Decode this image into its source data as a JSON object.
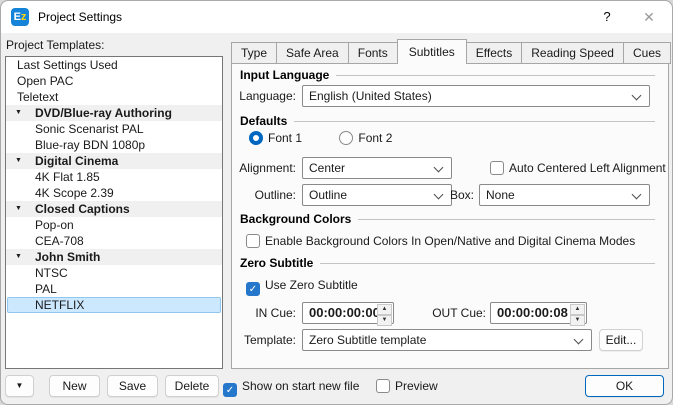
{
  "window": {
    "title": "Project Settings",
    "help_glyph": "?",
    "close_glyph": "✕",
    "icon_e": "E",
    "icon_z": "z"
  },
  "colors": {
    "accent": "#0067c0",
    "checkbox_checked": "#2577cb",
    "selection_bg": "#cce8ff",
    "selection_border": "#8fc7ef",
    "titlebar_bg": "#ffffff",
    "dialog_bg": "#f0f0f0",
    "panel_bg": "#fbfbfb"
  },
  "left": {
    "label": "Project Templates:",
    "items": [
      {
        "label": "Last Settings Used",
        "type": "normal",
        "selected": false
      },
      {
        "label": "Open PAC",
        "type": "normal",
        "selected": false
      },
      {
        "label": "Teletext",
        "type": "normal",
        "selected": false
      },
      {
        "label": "DVD/Blue-ray Authoring",
        "type": "group",
        "selected": false
      },
      {
        "label": "Sonic Scenarist PAL",
        "type": "child",
        "selected": false
      },
      {
        "label": "Blue-ray BDN 1080p",
        "type": "child",
        "selected": false
      },
      {
        "label": "Digital Cinema",
        "type": "group",
        "selected": false
      },
      {
        "label": "4K Flat 1.85",
        "type": "child",
        "selected": false
      },
      {
        "label": "4K Scope 2.39",
        "type": "child",
        "selected": false
      },
      {
        "label": "Closed Captions",
        "type": "group",
        "selected": false
      },
      {
        "label": "Pop-on",
        "type": "child",
        "selected": false
      },
      {
        "label": "CEA-708",
        "type": "child",
        "selected": false
      },
      {
        "label": "John Smith",
        "type": "group",
        "selected": false
      },
      {
        "label": "NTSC",
        "type": "child",
        "selected": false
      },
      {
        "label": "PAL",
        "type": "child",
        "selected": false
      },
      {
        "label": "NETFLIX",
        "type": "child",
        "selected": true
      }
    ]
  },
  "tabs": {
    "labels": [
      "Type",
      "Safe Area",
      "Fonts",
      "Subtitles",
      "Effects",
      "Reading Speed",
      "Cues"
    ],
    "active": "Subtitles"
  },
  "input_language": {
    "header": "Input Language",
    "language_label": "Language:",
    "language_value": "English (United States)"
  },
  "defaults": {
    "header": "Defaults",
    "font1_label": "Font 1",
    "font1_selected": true,
    "font2_label": "Font 2",
    "font2_selected": false,
    "alignment_label": "Alignment:",
    "alignment_value": "Center",
    "auto_centered_label": "Auto Centered Left Alignment",
    "auto_centered_checked": false,
    "outline_label": "Outline:",
    "outline_value": "Outline",
    "box_label": "Box:",
    "box_value": "None"
  },
  "background_colors": {
    "header": "Background Colors",
    "enable_label": "Enable Background Colors In Open/Native and Digital Cinema Modes",
    "enable_checked": false
  },
  "zero_subtitle": {
    "header": "Zero Subtitle",
    "use_label": "Use Zero Subtitle",
    "use_checked": true,
    "in_cue_label": "IN Cue:",
    "in_cue_value": "00:00:00:00",
    "out_cue_label": "OUT Cue:",
    "out_cue_value": "00:00:00:08",
    "template_label": "Template:",
    "template_value": "Zero Subtitle template",
    "edit_button": "Edit..."
  },
  "footer": {
    "new_button": "New",
    "save_button": "Save",
    "delete_button": "Delete",
    "show_on_start_label": "Show on start new file",
    "show_on_start_checked": true,
    "preview_label": "Preview",
    "preview_checked": false,
    "ok_button": "OK"
  },
  "glyphs": {
    "check": "✓",
    "collapse": "▼",
    "spin_up": "▲",
    "spin_down": "▼"
  }
}
